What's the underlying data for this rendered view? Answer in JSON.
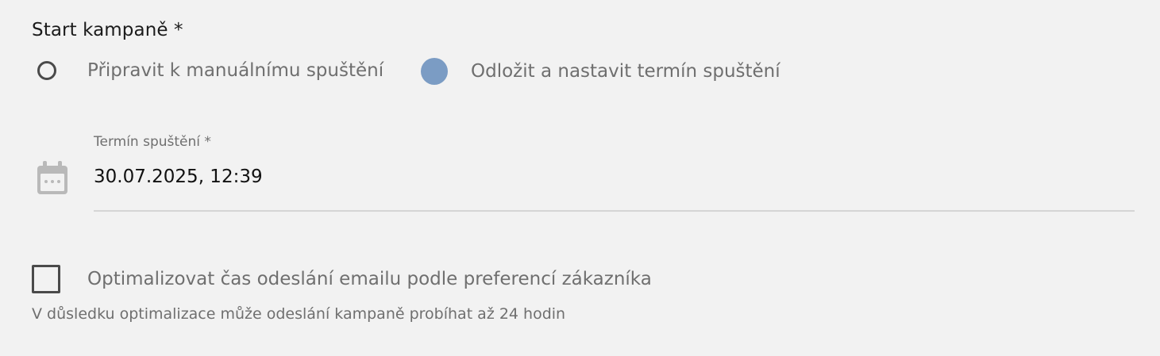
{
  "start": {
    "title": "Start kampaně *",
    "options": [
      {
        "label": "Připravit k manuálnímu spuštění",
        "selected": false
      },
      {
        "label": "Odložit a nastavit termín spuštění",
        "selected": true
      }
    ]
  },
  "schedule": {
    "label": "Termín spuštění *",
    "value": "30.07.2025, 12:39",
    "icon": "calendar-icon"
  },
  "optimize": {
    "label": "Optimalizovat čas odeslání emailu podle preferencí zákazníka",
    "checked": false,
    "hint": "V důsledku optimalizace může odeslání kampaně probíhat až 24 hodin"
  },
  "colors": {
    "background": "#f2f2f2",
    "radio_selected": "#7b9cc4",
    "text_muted": "#6f6f6f",
    "text_primary": "#1b1b1b"
  }
}
